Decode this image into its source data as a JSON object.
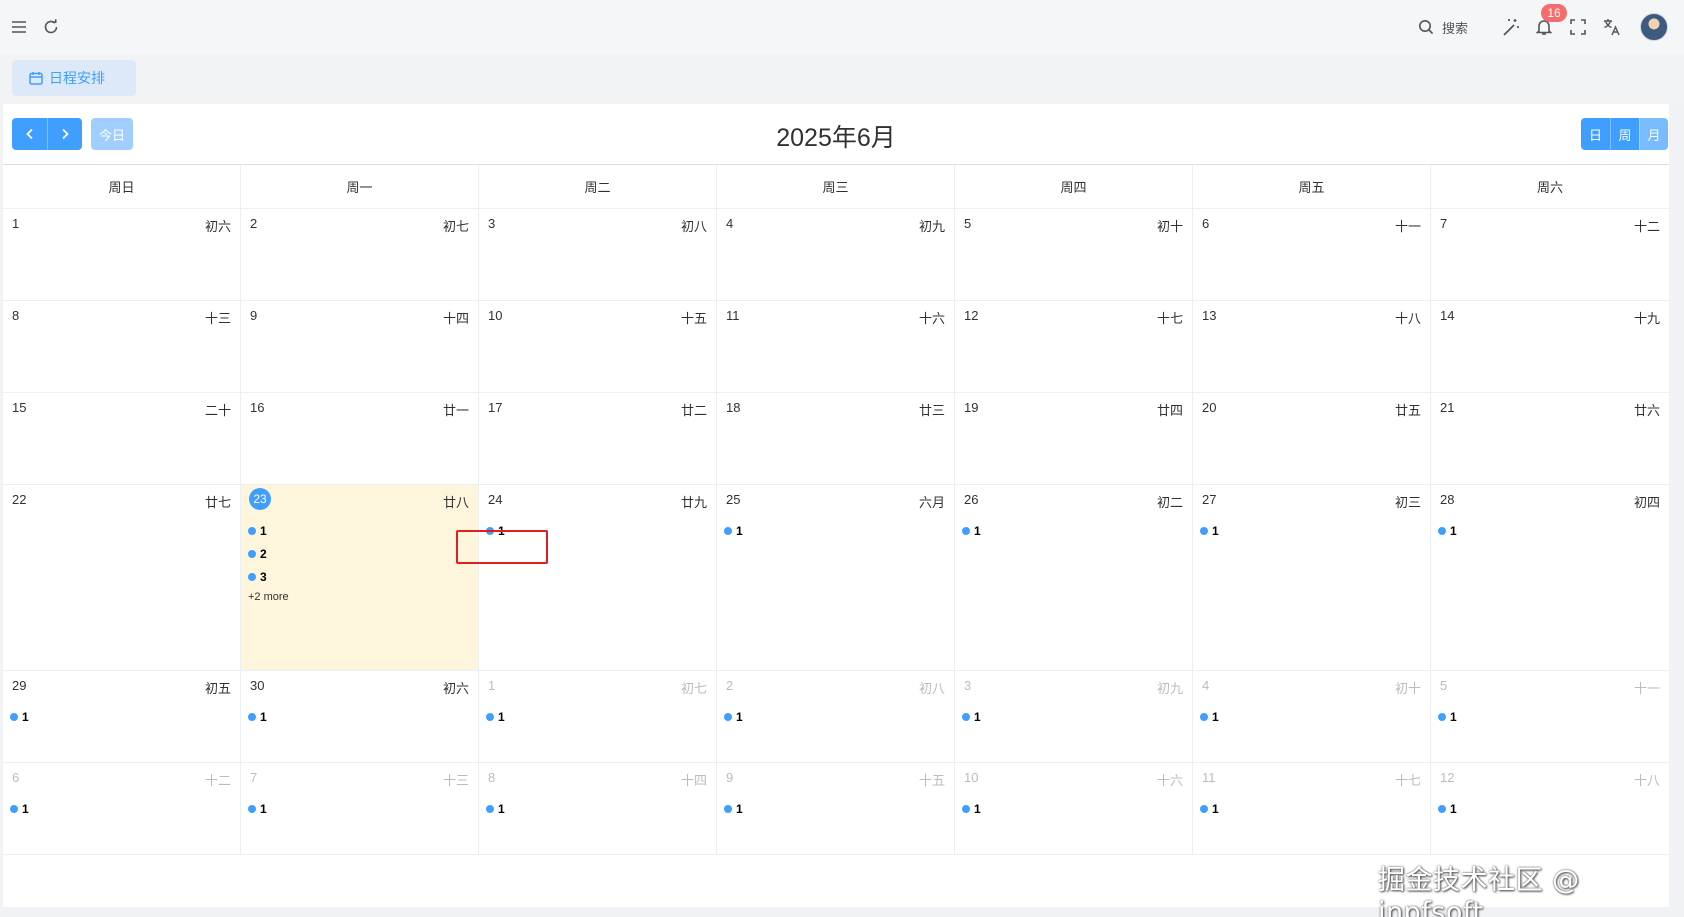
{
  "topbar": {
    "search_label": "搜索",
    "notification_count": "16",
    "icons": [
      "menu-icon",
      "refresh-icon",
      "search-icon",
      "magic-wand-icon",
      "bell-icon",
      "fullscreen-icon",
      "translate-icon"
    ]
  },
  "tabs": [
    {
      "label": "日程安排",
      "icon": "calendar-icon"
    }
  ],
  "calendar": {
    "title": "2025年6月",
    "today_label": "今日",
    "views": [
      "日",
      "周",
      "月"
    ],
    "active_view": "月",
    "weekdays": [
      "周日",
      "周一",
      "周二",
      "周三",
      "周四",
      "周五",
      "周六"
    ],
    "weeks": [
      [
        {
          "day": "1",
          "lunar": "初六",
          "other": false,
          "events": []
        },
        {
          "day": "2",
          "lunar": "初七",
          "other": false,
          "events": []
        },
        {
          "day": "3",
          "lunar": "初八",
          "other": false,
          "events": []
        },
        {
          "day": "4",
          "lunar": "初九",
          "other": false,
          "events": []
        },
        {
          "day": "5",
          "lunar": "初十",
          "other": false,
          "events": []
        },
        {
          "day": "6",
          "lunar": "十一",
          "other": false,
          "events": []
        },
        {
          "day": "7",
          "lunar": "十二",
          "other": false,
          "events": []
        }
      ],
      [
        {
          "day": "8",
          "lunar": "十三",
          "other": false,
          "events": []
        },
        {
          "day": "9",
          "lunar": "十四",
          "other": false,
          "events": []
        },
        {
          "day": "10",
          "lunar": "十五",
          "other": false,
          "events": []
        },
        {
          "day": "11",
          "lunar": "十六",
          "other": false,
          "events": []
        },
        {
          "day": "12",
          "lunar": "十七",
          "other": false,
          "events": []
        },
        {
          "day": "13",
          "lunar": "十八",
          "other": false,
          "events": []
        },
        {
          "day": "14",
          "lunar": "十九",
          "other": false,
          "events": []
        }
      ],
      [
        {
          "day": "15",
          "lunar": "二十",
          "other": false,
          "events": []
        },
        {
          "day": "16",
          "lunar": "廿一",
          "other": false,
          "events": []
        },
        {
          "day": "17",
          "lunar": "廿二",
          "other": false,
          "events": []
        },
        {
          "day": "18",
          "lunar": "廿三",
          "other": false,
          "events": []
        },
        {
          "day": "19",
          "lunar": "廿四",
          "other": false,
          "events": []
        },
        {
          "day": "20",
          "lunar": "廿五",
          "other": false,
          "events": []
        },
        {
          "day": "21",
          "lunar": "廿六",
          "other": false,
          "events": []
        }
      ],
      [
        {
          "day": "22",
          "lunar": "廿七",
          "other": false,
          "events": []
        },
        {
          "day": "23",
          "lunar": "廿八",
          "other": false,
          "today": true,
          "events": [
            "1",
            "2",
            "3"
          ],
          "more": "+2 more"
        },
        {
          "day": "24",
          "lunar": "廿九",
          "other": false,
          "events": [
            "1"
          ]
        },
        {
          "day": "25",
          "lunar": "六月",
          "other": false,
          "events": [
            "1"
          ]
        },
        {
          "day": "26",
          "lunar": "初二",
          "other": false,
          "events": [
            "1"
          ]
        },
        {
          "day": "27",
          "lunar": "初三",
          "other": false,
          "events": [
            "1"
          ]
        },
        {
          "day": "28",
          "lunar": "初四",
          "other": false,
          "events": [
            "1"
          ]
        }
      ],
      [
        {
          "day": "29",
          "lunar": "初五",
          "other": false,
          "events": [
            "1"
          ]
        },
        {
          "day": "30",
          "lunar": "初六",
          "other": false,
          "events": [
            "1"
          ]
        },
        {
          "day": "1",
          "lunar": "初七",
          "other": true,
          "events": [
            "1"
          ]
        },
        {
          "day": "2",
          "lunar": "初八",
          "other": true,
          "events": [
            "1"
          ]
        },
        {
          "day": "3",
          "lunar": "初九",
          "other": true,
          "events": [
            "1"
          ]
        },
        {
          "day": "4",
          "lunar": "初十",
          "other": true,
          "events": [
            "1"
          ]
        },
        {
          "day": "5",
          "lunar": "十一",
          "other": true,
          "events": [
            "1"
          ]
        }
      ],
      [
        {
          "day": "6",
          "lunar": "十二",
          "other": true,
          "events": [
            "1"
          ]
        },
        {
          "day": "7",
          "lunar": "十三",
          "other": true,
          "events": [
            "1"
          ]
        },
        {
          "day": "8",
          "lunar": "十四",
          "other": true,
          "events": [
            "1"
          ]
        },
        {
          "day": "9",
          "lunar": "十五",
          "other": true,
          "events": [
            "1"
          ]
        },
        {
          "day": "10",
          "lunar": "十六",
          "other": true,
          "events": [
            "1"
          ]
        },
        {
          "day": "11",
          "lunar": "十七",
          "other": true,
          "events": [
            "1"
          ]
        },
        {
          "day": "12",
          "lunar": "十八",
          "other": true,
          "events": [
            "1"
          ]
        }
      ]
    ]
  },
  "watermark": "掘金技术社区 @ jnpfsoft",
  "colors": {
    "accent": "#409eff",
    "today_bg": "#fdf6dc",
    "highlight": "#e02020",
    "badge": "#f56c6c"
  }
}
